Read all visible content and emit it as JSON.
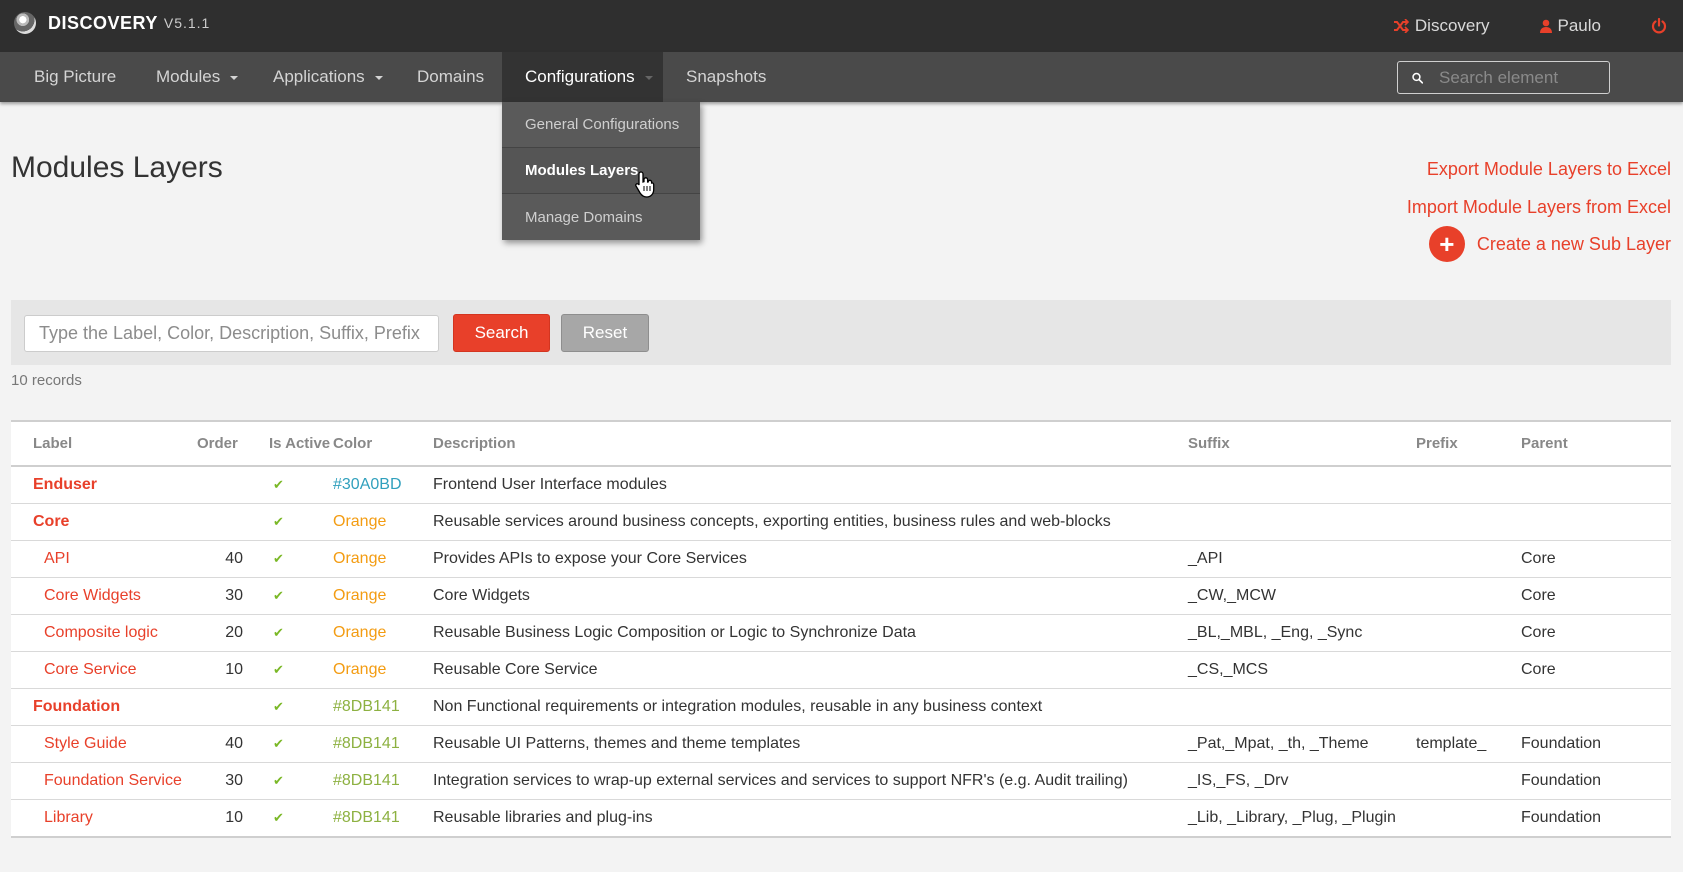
{
  "topbar": {
    "brand": "DISCOVERY",
    "version": "V5.1.1",
    "discovery_link": "Discovery",
    "user": "Paulo"
  },
  "nav": {
    "items": [
      {
        "label": "Big Picture"
      },
      {
        "label": "Modules"
      },
      {
        "label": "Applications"
      },
      {
        "label": "Domains"
      },
      {
        "label": "Configurations"
      },
      {
        "label": "Snapshots"
      }
    ],
    "search_placeholder": "Search element"
  },
  "dropdown": {
    "items": [
      "General Configurations",
      "Modules Layers",
      "Manage Domains"
    ]
  },
  "page": {
    "title": "Modules Layers",
    "export_link": "Export Module Layers to Excel",
    "import_link": "Import Module Layers from Excel",
    "create_link": "Create a new Sub Layer"
  },
  "filter": {
    "placeholder": "Type the Label, Color, Description, Suffix, Prefix",
    "search_label": "Search",
    "reset_label": "Reset",
    "records": "10 records"
  },
  "colors": {
    "accent": "#e8402a",
    "check": "#7ab826",
    "orange": "#f39c12",
    "blue": "#30A0BD",
    "green": "#8DB141"
  },
  "table": {
    "headers": [
      "Label",
      "Order",
      "Is Active",
      "Color",
      "Description",
      "Suffix",
      "Prefix",
      "Parent"
    ],
    "rows": [
      {
        "label": "Enduser",
        "level": "parent",
        "order": "",
        "active": true,
        "color": "#30A0BD",
        "color_hex": "#30A0BD",
        "description": "Frontend User Interface modules",
        "suffix": "",
        "prefix": "",
        "parent": ""
      },
      {
        "label": "Core",
        "level": "parent",
        "order": "",
        "active": true,
        "color": "Orange",
        "color_hex": "#f39c12",
        "description": "Reusable services around business concepts, exporting entities, business rules and web-blocks",
        "suffix": "",
        "prefix": "",
        "parent": ""
      },
      {
        "label": "API",
        "level": "child",
        "order": "40",
        "active": true,
        "color": "Orange",
        "color_hex": "#f39c12",
        "description": "Provides APIs to expose your Core Services",
        "suffix": "_API",
        "prefix": "",
        "parent": "Core"
      },
      {
        "label": "Core Widgets",
        "level": "child",
        "order": "30",
        "active": true,
        "color": "Orange",
        "color_hex": "#f39c12",
        "description": "Core Widgets",
        "suffix": "_CW,_MCW",
        "prefix": "",
        "parent": "Core"
      },
      {
        "label": "Composite logic",
        "level": "child",
        "order": "20",
        "active": true,
        "color": "Orange",
        "color_hex": "#f39c12",
        "description": "Reusable Business Logic Composition or Logic to Synchronize Data",
        "suffix": "_BL,_MBL, _Eng, _Sync",
        "prefix": "",
        "parent": "Core"
      },
      {
        "label": "Core Service",
        "level": "child",
        "order": "10",
        "active": true,
        "color": "Orange",
        "color_hex": "#f39c12",
        "description": "Reusable Core Service",
        "suffix": "_CS,_MCS",
        "prefix": "",
        "parent": "Core"
      },
      {
        "label": "Foundation",
        "level": "parent",
        "order": "",
        "active": true,
        "color": "#8DB141",
        "color_hex": "#8DB141",
        "description": "Non Functional requirements or integration modules, reusable in any business context",
        "suffix": "",
        "prefix": "",
        "parent": ""
      },
      {
        "label": "Style Guide",
        "level": "child",
        "order": "40",
        "active": true,
        "color": "#8DB141",
        "color_hex": "#8DB141",
        "description": "Reusable UI Patterns, themes and theme templates",
        "suffix": "_Pat,_Mpat, _th, _Theme",
        "prefix": "template_",
        "parent": "Foundation"
      },
      {
        "label": "Foundation Service",
        "level": "child",
        "order": "30",
        "active": true,
        "color": "#8DB141",
        "color_hex": "#8DB141",
        "description": "Integration services to wrap-up external services and services to support NFR's (e.g. Audit trailing)",
        "suffix": "_IS,_FS, _Drv",
        "prefix": "",
        "parent": "Foundation"
      },
      {
        "label": "Library",
        "level": "child",
        "order": "10",
        "active": true,
        "color": "#8DB141",
        "color_hex": "#8DB141",
        "description": "Reusable libraries and plug-ins",
        "suffix": "_Lib, _Library, _Plug, _Plugin",
        "prefix": "",
        "parent": "Foundation"
      }
    ]
  }
}
